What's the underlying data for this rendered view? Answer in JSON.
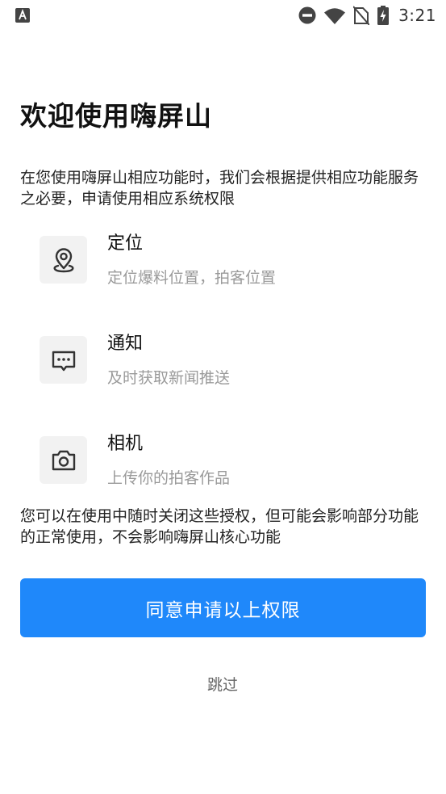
{
  "status_bar": {
    "time": "3:21",
    "icons": [
      "app-notification-icon",
      "do-not-disturb-icon",
      "wifi-icon",
      "no-sim-icon",
      "battery-charging-icon"
    ]
  },
  "title": "欢迎使用嗨屏山",
  "intro": "在您使用嗨屏山相应功能时，我们会根据提供相应功能服务之必要，申请使用相应系统权限",
  "permissions": [
    {
      "name": "定位",
      "description": "定位爆料位置，拍客位置",
      "icon": "location-pin-icon"
    },
    {
      "name": "通知",
      "description": "及时获取新闻推送",
      "icon": "message-dots-icon"
    },
    {
      "name": "相机",
      "description": "上传你的拍客作品",
      "icon": "camera-icon"
    }
  ],
  "note": "您可以在使用中随时关闭这些授权，但可能会影响部分功能的正常使用，不会影响嗨屏山核心功能",
  "agree_label": "同意申请以上权限",
  "skip_label": "跳过",
  "colors": {
    "primary": "#1f88fa",
    "icon_background": "#f2f2f2",
    "secondary_text": "#9a9a9a"
  }
}
